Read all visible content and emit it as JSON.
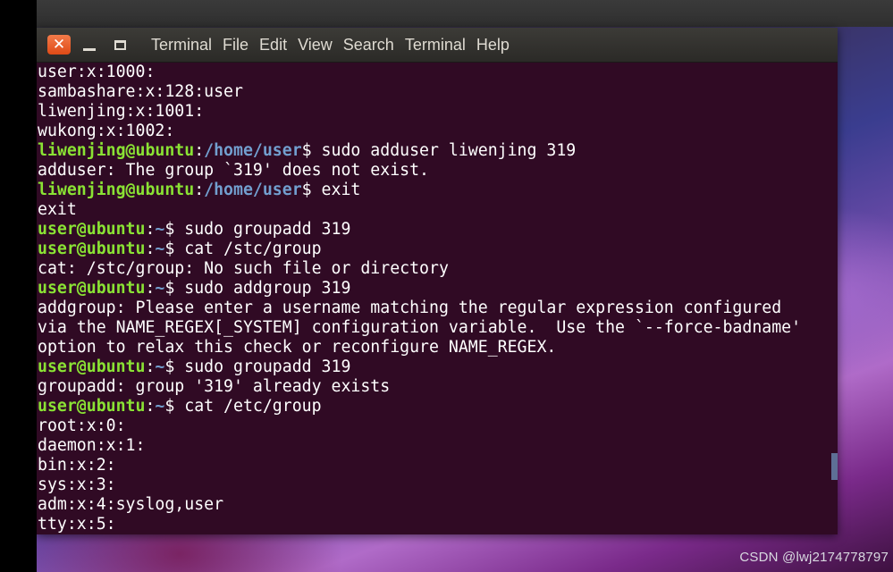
{
  "window": {
    "menu": [
      "Terminal",
      "File",
      "Edit",
      "View",
      "Search",
      "Terminal",
      "Help"
    ]
  },
  "watermark": "CSDN @lwj2174778797",
  "colors": {
    "terminal_bg": "#300a24",
    "prompt_user": "#8ae234",
    "prompt_path": "#729fcf",
    "close_button": "#e95420"
  },
  "icons": [
    "close-icon",
    "minimize-icon",
    "maximize-icon"
  ],
  "terminal": {
    "lines": [
      {
        "type": "out",
        "text": "user:x:1000:"
      },
      {
        "type": "out",
        "text": "sambashare:x:128:user"
      },
      {
        "type": "out",
        "text": "liwenjing:x:1001:"
      },
      {
        "type": "out",
        "text": "wukong:x:1002:"
      },
      {
        "type": "prompt",
        "user": "liwenjing@ubuntu",
        "path": "/home/user",
        "cmd": " sudo adduser liwenjing 319"
      },
      {
        "type": "out",
        "text": "adduser: The group `319' does not exist."
      },
      {
        "type": "prompt",
        "user": "liwenjing@ubuntu",
        "path": "/home/user",
        "cmd": " exit"
      },
      {
        "type": "out",
        "text": "exit"
      },
      {
        "type": "prompt",
        "user": "user@ubuntu",
        "path": "~",
        "cmd": " sudo groupadd 319"
      },
      {
        "type": "prompt",
        "user": "user@ubuntu",
        "path": "~",
        "cmd": " cat /stc/group"
      },
      {
        "type": "out",
        "text": "cat: /stc/group: No such file or directory"
      },
      {
        "type": "prompt",
        "user": "user@ubuntu",
        "path": "~",
        "cmd": " sudo addgroup 319"
      },
      {
        "type": "out",
        "text": "addgroup: Please enter a username matching the regular expression configured"
      },
      {
        "type": "out",
        "text": "via the NAME_REGEX[_SYSTEM] configuration variable.  Use the `--force-badname'"
      },
      {
        "type": "out",
        "text": "option to relax this check or reconfigure NAME_REGEX."
      },
      {
        "type": "prompt",
        "user": "user@ubuntu",
        "path": "~",
        "cmd": " sudo groupadd 319"
      },
      {
        "type": "out",
        "text": "groupadd: group '319' already exists"
      },
      {
        "type": "prompt",
        "user": "user@ubuntu",
        "path": "~",
        "cmd": " cat /etc/group"
      },
      {
        "type": "out",
        "text": "root:x:0:"
      },
      {
        "type": "out",
        "text": "daemon:x:1:"
      },
      {
        "type": "out",
        "text": "bin:x:2:"
      },
      {
        "type": "out",
        "text": "sys:x:3:"
      },
      {
        "type": "out",
        "text": "adm:x:4:syslog,user"
      },
      {
        "type": "out",
        "text": "tty:x:5:"
      }
    ]
  }
}
